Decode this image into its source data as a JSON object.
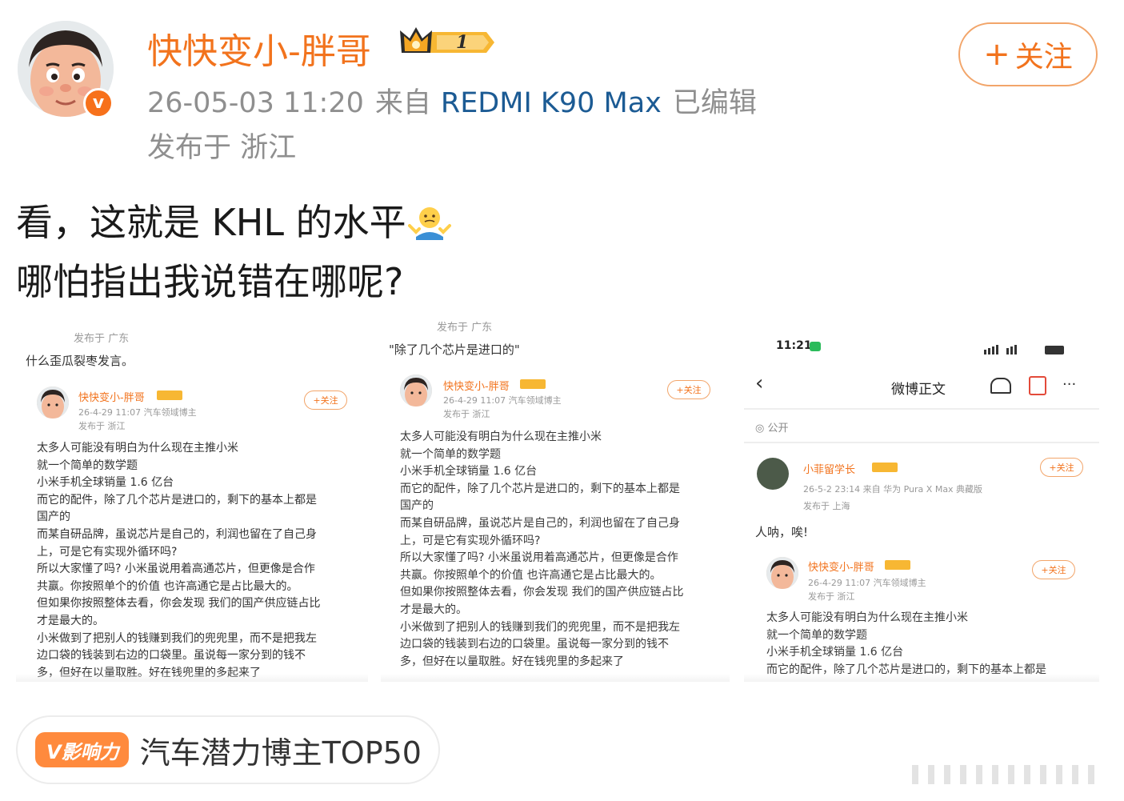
{
  "user": {
    "name": "快快变小-胖哥",
    "verified_icon": "v-verified-icon",
    "vip_icon": "crown-vip-icon",
    "vip_level": "1"
  },
  "meta": {
    "date": "26-05-03 11:20",
    "from_label": "来自",
    "device": "REDMI K90 Max",
    "edited": "已编辑",
    "location": "发布于 浙江"
  },
  "follow": {
    "label": "关注",
    "icon": "plus-icon"
  },
  "post": {
    "line1": "看，这就是 KHL 的水平",
    "line1_emoji": "shrug-emoji",
    "line2": "哪怕指出我说错在哪呢?"
  },
  "images": [
    {
      "location_line": "发布于 广东",
      "comment": "什么歪瓜裂枣发言。",
      "card": {
        "name": "快快变小-胖哥",
        "meta": "26-4-29 11:07  汽车领域博主",
        "location": "发布于 浙江",
        "follow": "+关注"
      },
      "lines": [
        "太多人可能没有明白为什么现在主推小米",
        "就一个简单的数学题",
        "小米手机全球销量 1.6 亿台",
        "而它的配件，除了几个芯片是进口的，剩下的基本上都是",
        "国产的",
        "而某自研品牌，虽说芯片是自己的，利润也留在了自己身",
        "上，可是它有实现外循环吗?",
        "所以大家懂了吗? 小米虽说用着高通芯片，但更像是合作",
        "共赢。你按照单个的价值 也许高通它是占比最大的。",
        "但如果你按照整体去看，你会发现 我们的国产供应链占比",
        "才是最大的。",
        "小米做到了把别人的钱赚到我们的兜兜里，而不是把我左",
        "边口袋的钱装到右边的口袋里。虽说每一家分到的钱不",
        "多，但好在以量取胜。好在钱兜里的多起来了"
      ]
    },
    {
      "location_line": "发布于 广东",
      "comment": "\"除了几个芯片是进口的\"",
      "card": {
        "name": "快快变小-胖哥",
        "meta": "26-4-29 11:07  汽车领域博主",
        "location": "发布于 浙江",
        "follow": "+关注"
      },
      "lines": [
        "太多人可能没有明白为什么现在主推小米",
        "就一个简单的数学题",
        "小米手机全球销量 1.6 亿台",
        "而它的配件，除了几个芯片是进口的，剩下的基本上都是",
        "国产的",
        "而某自研品牌，虽说芯片是自己的，利润也留在了自己身",
        "上，可是它有实现外循环吗?",
        "所以大家懂了吗? 小米虽说用着高通芯片，但更像是合作",
        "共赢。你按照单个的价值 也许高通它是占比最大的。",
        "但如果你按照整体去看，你会发现 我们的国产供应链占比",
        "才是最大的。",
        "小米做到了把别人的钱赚到我们的兜兜里，而不是把我左",
        "边口袋的钱装到右边的口袋里。虽说每一家分到的钱不",
        "多，但好在以量取胜。好在钱兜里的多起来了"
      ]
    },
    {
      "status_time": "11:21",
      "nav_title": "微博正文",
      "visibility": "公开",
      "reposter": {
        "name": "小菲留学长",
        "meta": "26-5-2 23:14  来自 华为 Pura X Max 典藏版",
        "location": "发布于 上海",
        "follow": "+关注",
        "comment": "人呐，唉!"
      },
      "card": {
        "name": "快快变小-胖哥",
        "meta": "26-4-29 11:07  汽车领域博主",
        "location": "发布于 浙江",
        "follow": "+关注"
      },
      "lines": [
        "太多人可能没有明白为什么现在主推小米",
        "就一个简单的数学题",
        "小米手机全球销量 1.6 亿台",
        "而它的配件，除了几个芯片是进口的，剩下的基本上都是"
      ]
    }
  ],
  "influence": {
    "badge": "V影响力",
    "text": "汽车潜力博主TOP50"
  }
}
